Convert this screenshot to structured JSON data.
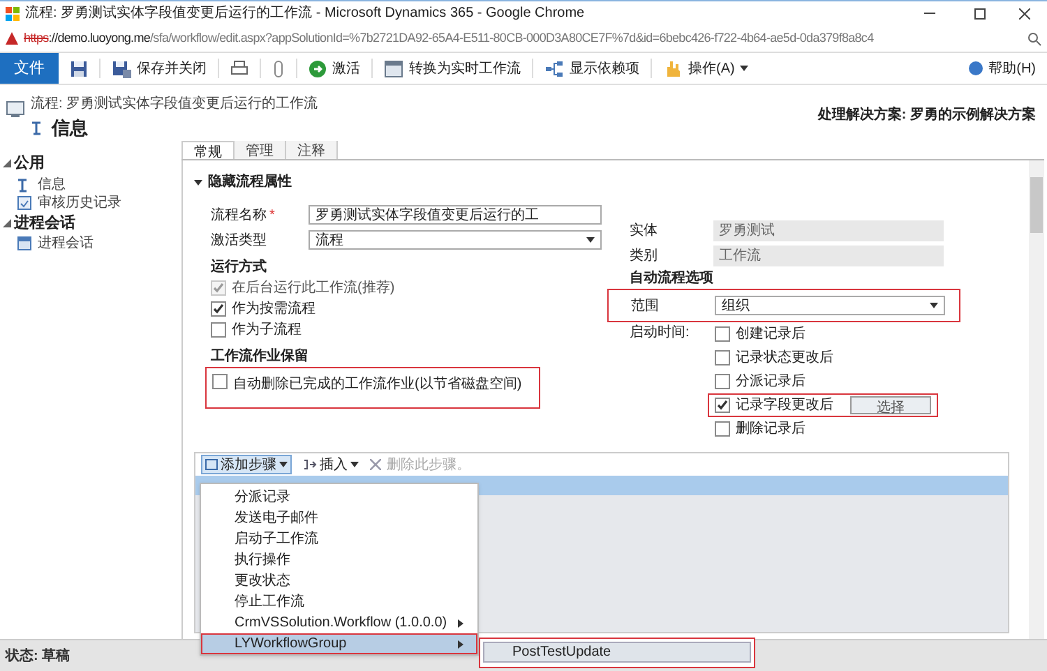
{
  "window": {
    "title": "流程: 罗勇测试实体字段值变更后运行的工作流 - Microsoft Dynamics 365 - Google Chrome"
  },
  "address_bar": {
    "scheme": "https",
    "host": "://demo.luoyong.me",
    "path": "/sfa/workflow/edit.aspx?appSolutionId=%7b2721DA92-65A4-E511-80CB-000D3A80CE7F%7d&id=6bebc426-f722-4b64-ae5d-0da379f8a8c4",
    "insecure": true
  },
  "ribbon": {
    "file_tab": "文件",
    "buttons": [
      {
        "kind": "icon"
      },
      {
        "kind": "labeled",
        "label": "保存并关闭"
      },
      {
        "kind": "icon"
      },
      {
        "kind": "icon"
      },
      {
        "kind": "labeled",
        "label": "激活"
      },
      {
        "kind": "labeled",
        "label": "转换为实时工作流"
      },
      {
        "kind": "labeled",
        "label": "显示依赖项"
      },
      {
        "kind": "menu",
        "label": "操作(A)"
      }
    ],
    "help": "帮助(H)"
  },
  "header": {
    "breadcrumb": "流程: 罗勇测试实体字段值变更后运行的工作流",
    "title": "信息",
    "solution": "处理解决方案: 罗勇的示例解决方案"
  },
  "sidebar": {
    "groups": [
      {
        "label": "公用",
        "expanded": true,
        "items": [
          {
            "label": "信息"
          },
          {
            "label": "审核历史记录"
          }
        ]
      },
      {
        "label": "进程会话",
        "expanded": true,
        "items": [
          {
            "label": "进程会话"
          }
        ]
      }
    ]
  },
  "tabs": [
    {
      "label": "常规",
      "selected": true
    },
    {
      "label": "管理",
      "selected": false
    },
    {
      "label": "注释",
      "selected": false
    }
  ],
  "section": {
    "title": "隐藏流程属性",
    "expanded": true
  },
  "left_fields": [
    {
      "kind": "text",
      "label": "流程名称",
      "required_mark": "*",
      "value": "罗勇测试实体字段值变更后运行的工"
    },
    {
      "kind": "select",
      "label": "激活类型",
      "value": "流程"
    }
  ],
  "run_mode": {
    "heading": "运行方式",
    "options": [
      {
        "label": "在后台运行此工作流(推荐)",
        "checked": true,
        "disabled": true
      },
      {
        "label": "作为按需流程",
        "checked": true,
        "disabled": false
      },
      {
        "label": "作为子流程",
        "checked": false,
        "disabled": false
      }
    ]
  },
  "retention": {
    "heading": "工作流作业保留",
    "option": {
      "label": "自动删除已完成的工作流作业(以节省磁盘空间)",
      "checked": false,
      "highlighted": true
    }
  },
  "right_fields": [
    {
      "label": "实体",
      "value": "罗勇测试"
    },
    {
      "label": "类别",
      "value": "工作流"
    }
  ],
  "auto_options": {
    "heading": "自动流程选项",
    "scope": {
      "label": "范围",
      "value": "组织",
      "highlighted": true
    },
    "start_label": "启动时间:",
    "triggers": [
      {
        "label": "创建记录后",
        "checked": false,
        "highlighted": false
      },
      {
        "label": "记录状态更改后",
        "checked": false,
        "highlighted": false
      },
      {
        "label": "分派记录后",
        "checked": false,
        "highlighted": false
      },
      {
        "label": "记录字段更改后",
        "checked": true,
        "highlighted": true,
        "button": "选择"
      },
      {
        "label": "删除记录后",
        "checked": false,
        "highlighted": false
      }
    ]
  },
  "steps_toolbar": {
    "add": "添加步骤",
    "insert": "插入",
    "delete": "删除此步骤。"
  },
  "step_menu": {
    "items": [
      {
        "kind": "item",
        "label": "分派记录",
        "selected": false
      },
      {
        "kind": "item",
        "label": "发送电子邮件",
        "selected": false
      },
      {
        "kind": "item",
        "label": "启动子工作流",
        "selected": false
      },
      {
        "kind": "item",
        "label": "执行操作",
        "selected": false
      },
      {
        "kind": "item",
        "label": "更改状态",
        "selected": false
      },
      {
        "kind": "item",
        "label": "停止工作流",
        "selected": false
      },
      {
        "kind": "submenu",
        "label": "CrmVSSolution.Workflow (1.0.0.0)",
        "selected": false
      },
      {
        "kind": "submenu",
        "label": "LYWorkflowGroup",
        "selected": true
      }
    ],
    "submenu": [
      "PostTestUpdate"
    ]
  },
  "status_bar": {
    "status": "状态: 草稿"
  }
}
